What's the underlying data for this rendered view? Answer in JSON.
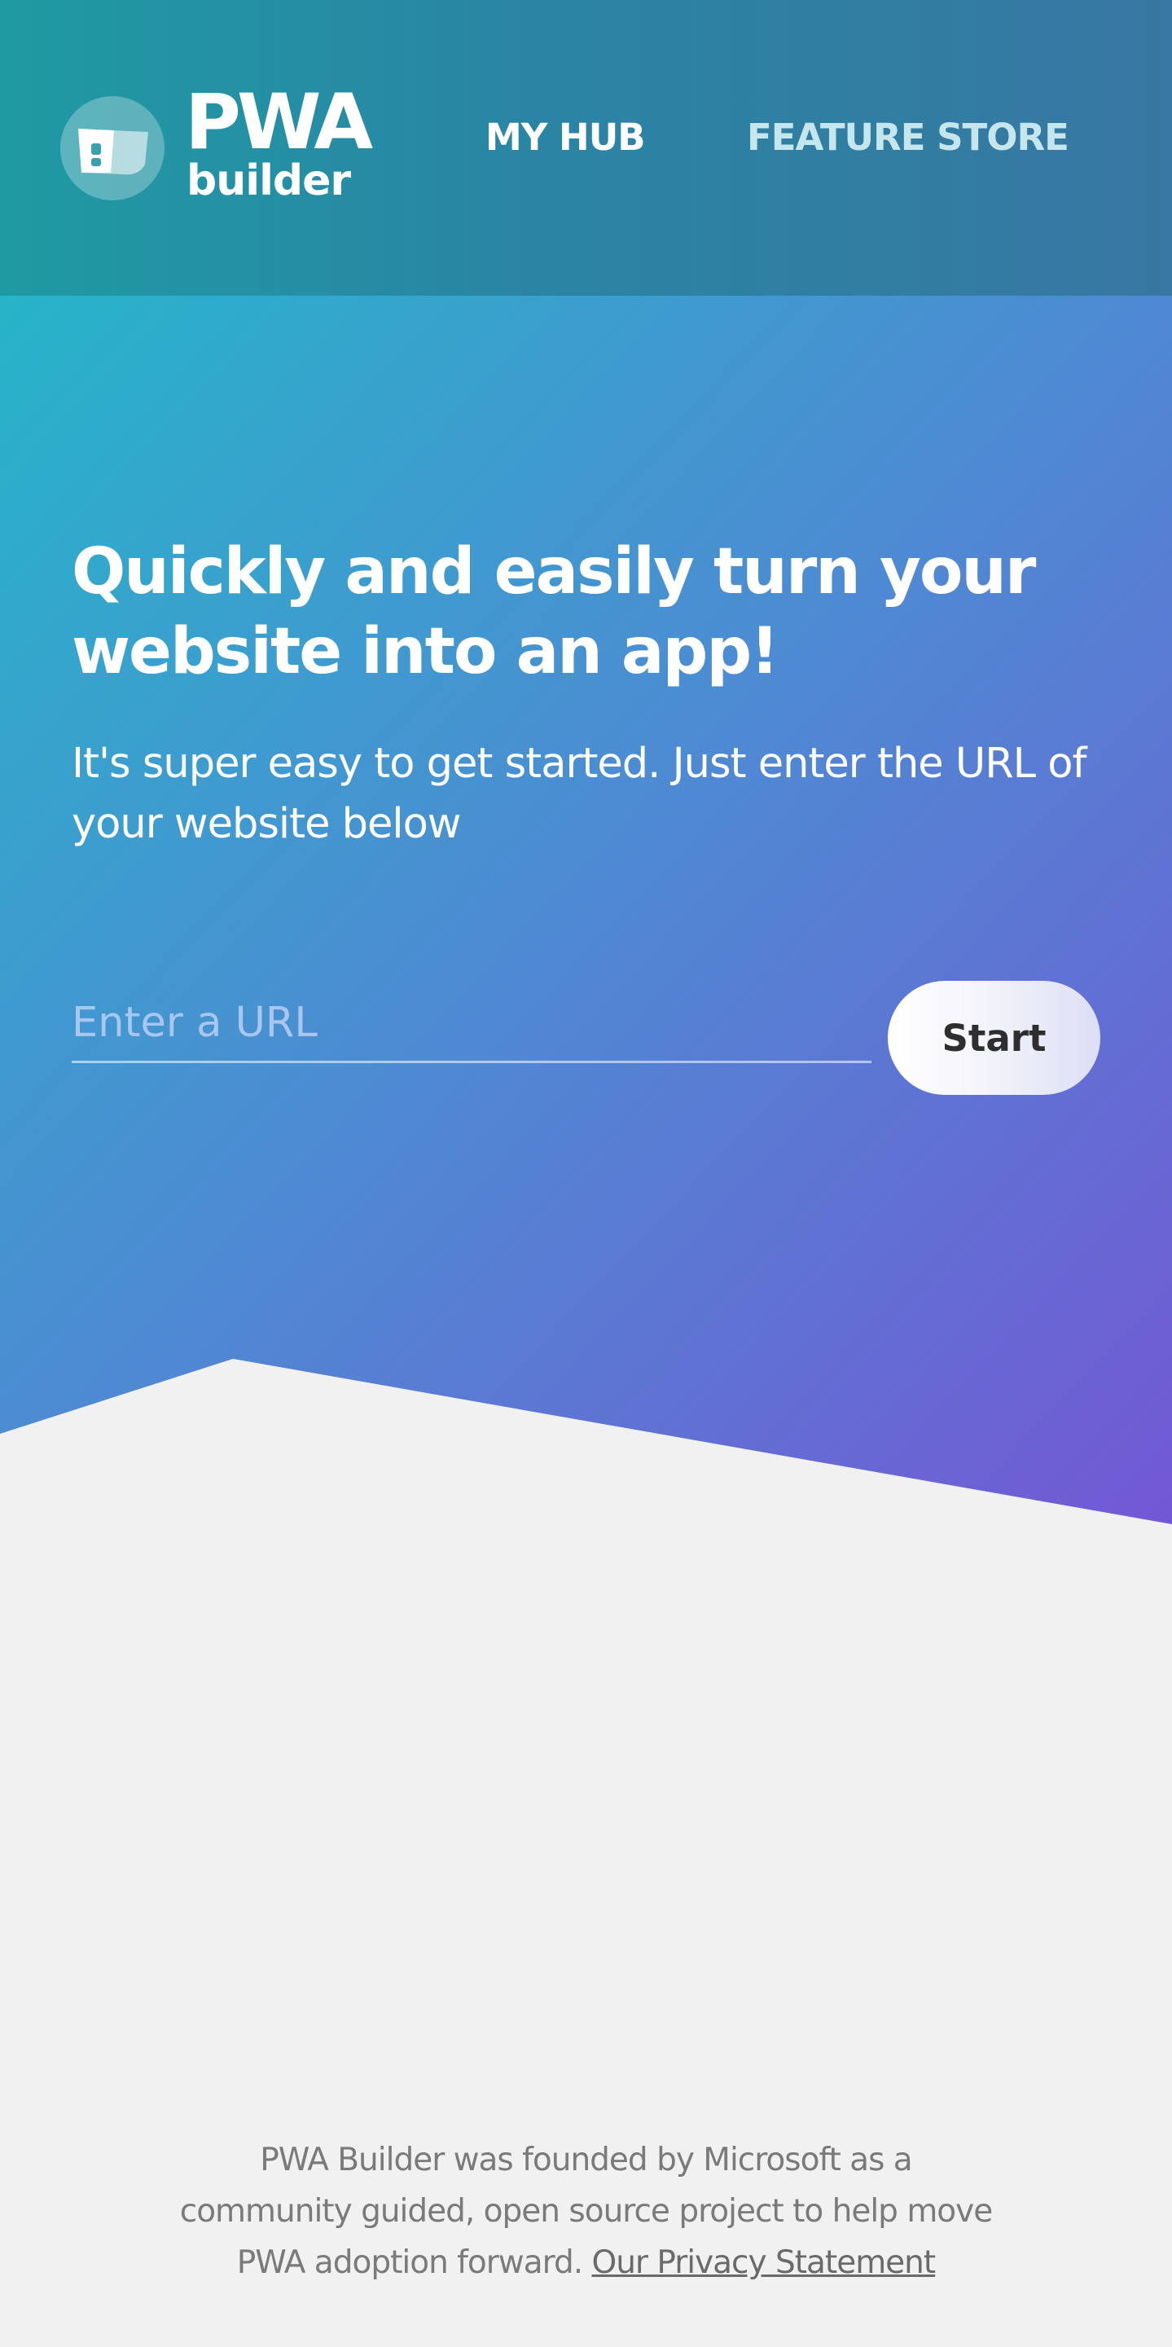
{
  "header": {
    "logo": {
      "wordmark_top": "PWA",
      "wordmark_bottom": "builder"
    },
    "nav": [
      {
        "label": "MY HUB"
      },
      {
        "label": "FEATURE STORE"
      }
    ]
  },
  "hero": {
    "title": "Quickly and easily turn your website into an app!",
    "subtitle": "It's super easy to get started. Just enter the URL of your website below",
    "url_input": {
      "placeholder": "Enter a URL",
      "value": ""
    },
    "start_label": "Start"
  },
  "footer": {
    "text": "PWA Builder was founded by Microsoft as a community guided, open source project to help move PWA adoption forward.",
    "privacy_link": "Our Privacy Statement"
  },
  "colors": {
    "header_gradient": [
      "#1f9aa3",
      "#3777a1"
    ],
    "hero_gradient": [
      "#27b4c9",
      "#4a8fd2",
      "#6f5fd4"
    ],
    "page_background": "#f1f1f1",
    "footer_text": "#7a7a7a"
  },
  "icons": {
    "logo_badge": "pwa-builder-logo-icon"
  }
}
